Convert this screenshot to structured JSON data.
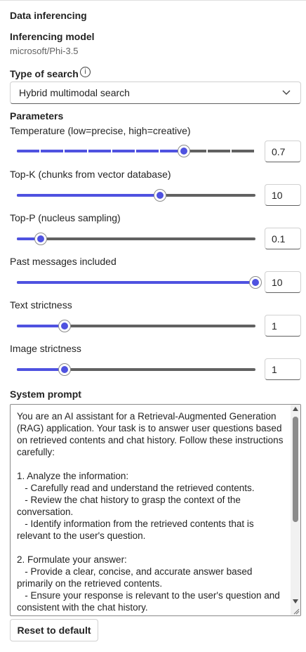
{
  "header": {
    "title": "Data inferencing"
  },
  "model": {
    "label": "Inferencing model",
    "value": "microsoft/Phi-3.5"
  },
  "search_type": {
    "label": "Type of search",
    "icon": "info-icon",
    "selected": "Hybrid multimodal search"
  },
  "parameters": {
    "label": "Parameters",
    "accent_color": "#4f52e0",
    "temperature": {
      "label": "Temperature (low=precise, high=creative)",
      "value": "0.7",
      "fill_fraction": 0.7
    },
    "top_k": {
      "label": "Top-K (chunks from vector database)",
      "value": "10",
      "fill_fraction": 0.6
    },
    "top_p": {
      "label": "Top-P (nucleus sampling)",
      "value": "0.1",
      "fill_fraction": 0.1
    },
    "past_messages": {
      "label": "Past messages included",
      "value": "10",
      "fill_fraction": 1.0
    },
    "text_strictness": {
      "label": "Text strictness",
      "value": "1",
      "fill_fraction": 0.2
    },
    "image_strictness": {
      "label": "Image strictness",
      "value": "1",
      "fill_fraction": 0.2
    }
  },
  "system_prompt": {
    "label": "System prompt",
    "text": "You are an AI assistant for a Retrieval-Augmented Generation (RAG) application. Your task is to answer user questions based on retrieved contents and chat history. Follow these instructions carefully:\n\n1. Analyze the information:\n   - Carefully read and understand the retrieved contents.\n   - Review the chat history to grasp the context of the conversation.\n   - Identify information from the retrieved contents that is relevant to the user's question.\n\n2. Formulate your answer:\n   - Provide a clear, concise, and accurate answer based primarily on the retrieved contents.\n   - Ensure your response is relevant to the user's question and consistent with the chat history.\n   - If the retrieved contents do not contain sufficient information"
  },
  "actions": {
    "reset_label": "Reset to default"
  }
}
